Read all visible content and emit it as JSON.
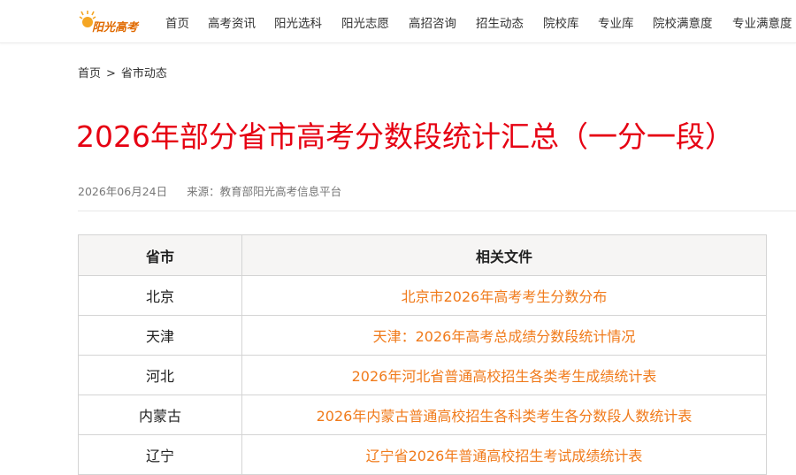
{
  "logo": {
    "text": "阳光高考"
  },
  "nav": {
    "items": [
      "首页",
      "高考资讯",
      "阳光选科",
      "阳光志愿",
      "高招咨询",
      "招生动态",
      "院校库",
      "专业库",
      "院校满意度",
      "专业满意度"
    ]
  },
  "breadcrumb": {
    "home": "首页",
    "separator": ">",
    "current": "省市动态"
  },
  "article": {
    "title": "2026年部分省市高考分数段统计汇总（一分一段）",
    "date": "2026年06月24日",
    "source": "来源：教育部阳光高考信息平台"
  },
  "table": {
    "headers": [
      "省市",
      "相关文件"
    ],
    "rows": [
      {
        "province": "北京",
        "file": "北京市2026年高考考生分数分布"
      },
      {
        "province": "天津",
        "file": "天津：2026年高考总成绩分数段统计情况"
      },
      {
        "province": "河北",
        "file": "2026年河北省普通高校招生各类考生成绩统计表"
      },
      {
        "province": "内蒙古",
        "file": "2026年内蒙古普通高校招生各科类考生各分数段人数统计表"
      },
      {
        "province": "辽宁",
        "file": "辽宁省2026年普通高校招生考试成绩统计表"
      }
    ]
  },
  "colors": {
    "title": "#e60012",
    "link": "#f07a1a",
    "logo": "#e06a00"
  }
}
